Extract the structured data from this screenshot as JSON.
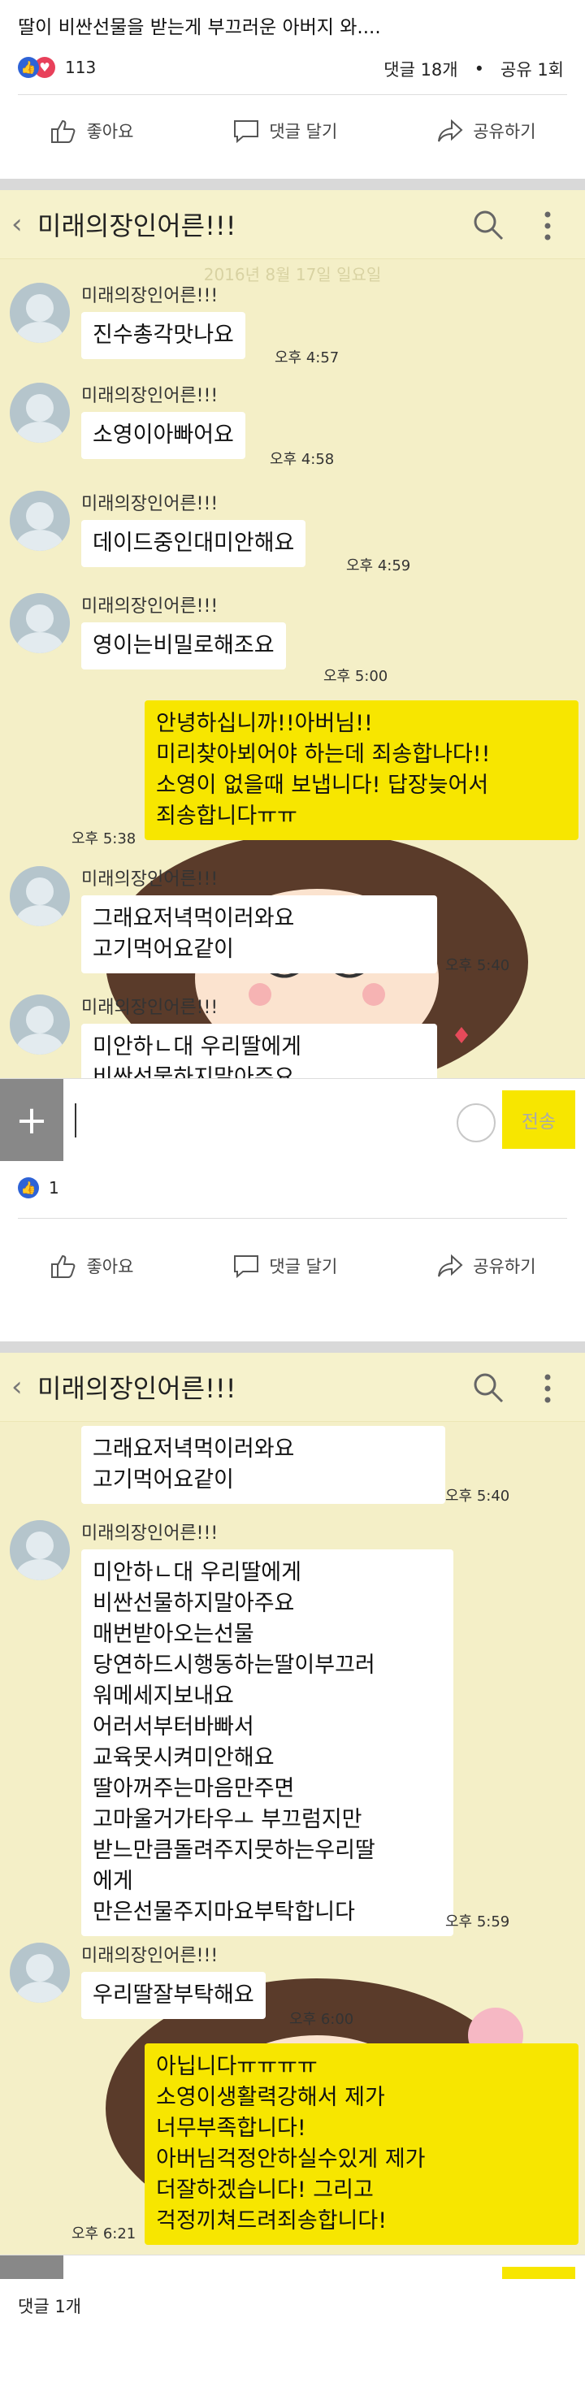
{
  "post": {
    "title": "딸이 비싼선물을 받는게 부끄러운 아버지 와....",
    "reaction_count": "113",
    "comments": "댓글 18개",
    "dot": "•",
    "shares": "공유 1회",
    "like_label": "좋아요",
    "comment_label": "댓글 달기",
    "share_label": "공유하기"
  },
  "second_post": {
    "reaction_count": "1",
    "like_label": "좋아요",
    "comment_label": "댓글 달기",
    "share_label": "공유하기",
    "comments_label": "댓글 1개"
  },
  "chat1": {
    "title": "미래의장인어른!!!",
    "date_stamp": "2016년 8월 17일 일요일",
    "send_label": "전송",
    "messages": [
      {
        "sender": "미래의장인어른!!!",
        "text": "진수총각맛나요",
        "time": "오후 4:57"
      },
      {
        "sender": "미래의장인어른!!!",
        "text": "소영이아빠어요",
        "time": "오후 4:58"
      },
      {
        "sender": "미래의장인어른!!!",
        "text": "데이드중인대미안해요",
        "time": "오후 4:59"
      },
      {
        "sender": "미래의장인어른!!!",
        "text": "영이는비밀로해조요",
        "time": "오후 5:00"
      },
      {
        "text": "안녕하십니까!!아버님!!\n미리찾아뵈어야 하는데 죄송합나다!!\n소영이 없을때 보냅니다! 답장늦어서\n죄송합니다ㅠㅠ",
        "time": "오후 5:38"
      },
      {
        "sender": "미래의장인어른!!!",
        "text": "그래요저녁먹이러와요\n고기먹어요같이",
        "time": "오후 5:40"
      },
      {
        "sender": "미래의장인어른!!!",
        "text": "미안하ㄴ대 우리딸에게\n비싼선물하지말아주요\n매번받아오는선물"
      }
    ]
  },
  "chat2": {
    "title": "미래의장인어른!!!",
    "send_label": "전송",
    "messages": [
      {
        "text": "그래요저녁먹이러와요\n고기먹어요같이",
        "time": "오후 5:40"
      },
      {
        "sender": "미래의장인어른!!!",
        "text": "미안하ㄴ대 우리딸에게\n비싼선물하지말아주요\n매번받아오는선물\n당연하드시행동하는딸이부끄러\n워메세지보내요\n어러서부터바빠서\n교육못시켜미안해요\n딸아꺼주는마음만주면\n고마울거가타우ㅗ 부끄럼지만\n받느만큼돌려주지뭇하는우리딸\n에게\n만은선물주지마요부탁합니다",
        "time": "오후 5:59"
      },
      {
        "sender": "미래의장인어른!!!",
        "text": "우리딸잘부탁해요",
        "time": "오후 6:00"
      },
      {
        "text": "아닙니다ㅠㅠㅠㅠ\n소영이생활력강해서 제가\n너무부족합니다!\n아버님걱정안하실수있게 제가\n더잘하겠습니다! 그리고\n걱정끼쳐드려죄송합니다!",
        "time": "오후 6:21"
      }
    ]
  }
}
